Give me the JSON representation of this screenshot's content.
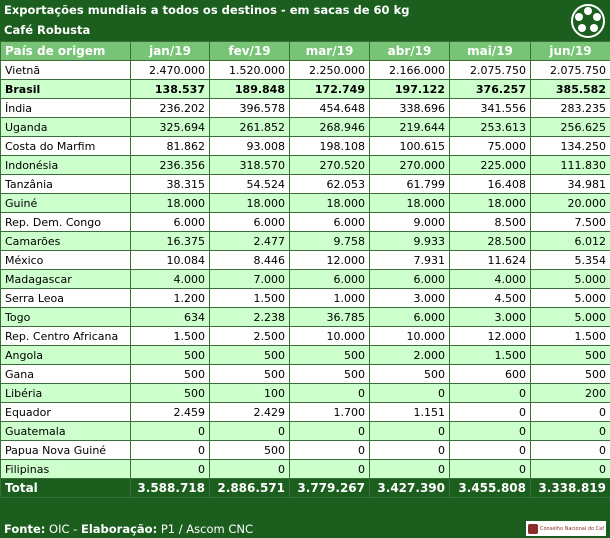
{
  "title": "Exportações mundiais a todos os destinos - em sacas de 60 kg",
  "subtitle": "Café Robusta",
  "columns": [
    "País de origem",
    "jan/19",
    "fev/19",
    "mar/19",
    "abr/19",
    "mai/19",
    "jun/19"
  ],
  "rows": [
    {
      "country": "Vietnã",
      "values": [
        "2.470.000",
        "1.520.000",
        "2.250.000",
        "2.166.000",
        "2.075.750",
        "2.075.750"
      ]
    },
    {
      "country": "Brasil",
      "values": [
        "138.537",
        "189.848",
        "172.749",
        "197.122",
        "376.257",
        "385.582"
      ]
    },
    {
      "country": "Índia",
      "values": [
        "236.202",
        "396.578",
        "454.648",
        "338.696",
        "341.556",
        "283.235"
      ]
    },
    {
      "country": "Uganda",
      "values": [
        "325.694",
        "261.852",
        "268.946",
        "219.644",
        "253.613",
        "256.625"
      ]
    },
    {
      "country": "Costa do Marfim",
      "values": [
        "81.862",
        "93.008",
        "198.108",
        "100.615",
        "75.000",
        "134.250"
      ]
    },
    {
      "country": "Indonésia",
      "values": [
        "236.356",
        "318.570",
        "270.520",
        "270.000",
        "225.000",
        "111.830"
      ]
    },
    {
      "country": "Tanzânia",
      "values": [
        "38.315",
        "54.524",
        "62.053",
        "61.799",
        "16.408",
        "34.981"
      ]
    },
    {
      "country": "Guiné",
      "values": [
        "18.000",
        "18.000",
        "18.000",
        "18.000",
        "18.000",
        "20.000"
      ]
    },
    {
      "country": "Rep. Dem. Congo",
      "values": [
        "6.000",
        "6.000",
        "6.000",
        "9.000",
        "8.500",
        "7.500"
      ]
    },
    {
      "country": "Camarões",
      "values": [
        "16.375",
        "2.477",
        "9.758",
        "9.933",
        "28.500",
        "6.012"
      ]
    },
    {
      "country": "México",
      "values": [
        "10.084",
        "8.446",
        "12.000",
        "7.931",
        "11.624",
        "5.354"
      ]
    },
    {
      "country": "Madagascar",
      "values": [
        "4.000",
        "7.000",
        "6.000",
        "6.000",
        "4.000",
        "5.000"
      ]
    },
    {
      "country": "Serra Leoa",
      "values": [
        "1.200",
        "1.500",
        "1.000",
        "3.000",
        "4.500",
        "5.000"
      ]
    },
    {
      "country": "Togo",
      "values": [
        "634",
        "2.238",
        "36.785",
        "6.000",
        "3.000",
        "5.000"
      ]
    },
    {
      "country": "Rep. Centro Africana",
      "values": [
        "1.500",
        "2.500",
        "10.000",
        "10.000",
        "12.000",
        "1.500"
      ]
    },
    {
      "country": "Angola",
      "values": [
        "500",
        "500",
        "500",
        "2.000",
        "1.500",
        "500"
      ]
    },
    {
      "country": "Gana",
      "values": [
        "500",
        "500",
        "500",
        "500",
        "600",
        "500"
      ]
    },
    {
      "country": "Libéria",
      "values": [
        "500",
        "100",
        "0",
        "0",
        "0",
        "200"
      ]
    },
    {
      "country": "Equador",
      "values": [
        "2.459",
        "2.429",
        "1.700",
        "1.151",
        "0",
        "0"
      ]
    },
    {
      "country": "Guatemala",
      "values": [
        "0",
        "0",
        "0",
        "0",
        "0",
        "0"
      ]
    },
    {
      "country": "Papua Nova Guiné",
      "values": [
        "0",
        "500",
        "0",
        "0",
        "0",
        "0"
      ]
    },
    {
      "country": "Filipinas",
      "values": [
        "0",
        "0",
        "0",
        "0",
        "0",
        "0"
      ]
    }
  ],
  "total": {
    "label": "Total",
    "values": [
      "3.588.718",
      "2.886.571",
      "3.779.267",
      "3.427.390",
      "3.455.808",
      "3.338.819"
    ]
  },
  "footer": {
    "source_label": "Fonte:",
    "source": "OIC",
    "elab_label": "Elaboração:",
    "elab": "P1 / Ascom CNC"
  },
  "footer_logo_text": "Conselho Nacional do Café",
  "colors": {
    "dark_green": "#1b5e1e",
    "header_green": "#77c477",
    "light_green": "#ccffcc"
  }
}
